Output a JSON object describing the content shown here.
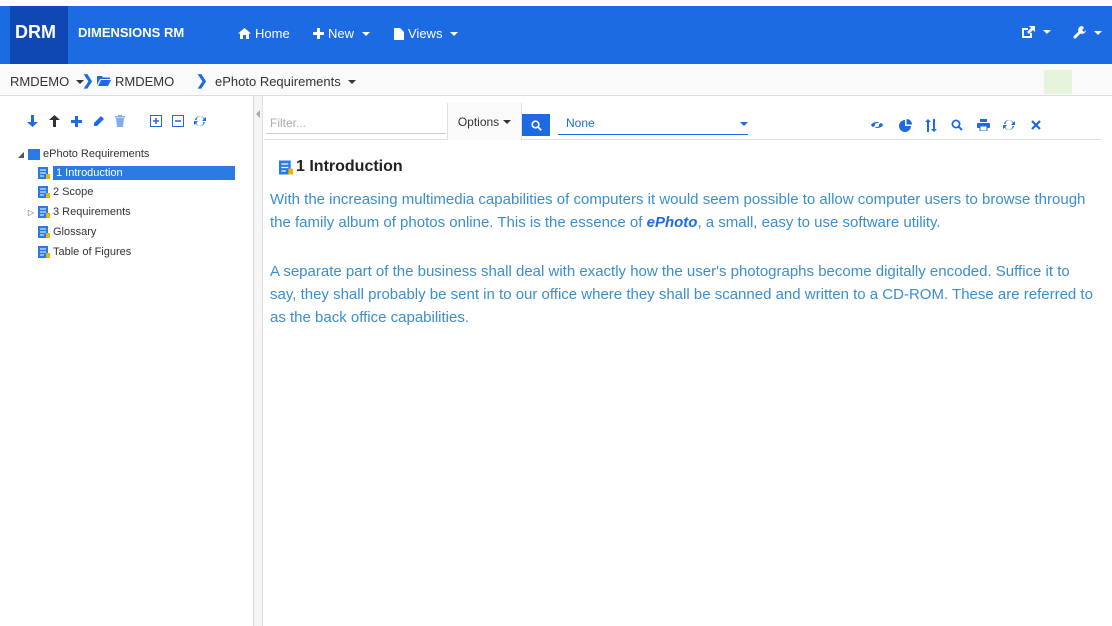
{
  "header": {
    "logo": "DRM",
    "product": "DIMENSIONS RM",
    "nav": [
      {
        "label": "Home",
        "icon": "home-icon"
      },
      {
        "label": "New",
        "icon": "plus-icon"
      },
      {
        "label": "Views",
        "icon": "file-icon"
      }
    ],
    "right_icons": [
      "export-icon",
      "wrench-icon"
    ],
    "accent": "#1c6be3"
  },
  "breadcrumb": {
    "items": [
      "RMDEMO",
      "RMDEMO",
      "ePhoto Requirements"
    ]
  },
  "left_toolbar": {
    "icons": [
      "arrow-down-icon",
      "arrow-up-icon",
      "plus-icon",
      "pencil-icon",
      "trash-icon",
      "expand-all-icon",
      "collapse-all-icon",
      "refresh-icon"
    ]
  },
  "tree": {
    "root": "ePhoto Requirements",
    "items": [
      {
        "label": "1 Introduction",
        "selected": true
      },
      {
        "label": "2 Scope",
        "selected": false
      },
      {
        "label": "3 Requirements",
        "selected": false,
        "expandable": true
      },
      {
        "label": "Glossary",
        "selected": false
      },
      {
        "label": "Table of Figures",
        "selected": false
      }
    ]
  },
  "right_toolbar": {
    "filter_placeholder": "Filter...",
    "options_label": "Options",
    "view_value": "None",
    "icons": [
      "eye-slash-icon",
      "pie-chart-icon",
      "sort-icon",
      "search-icon",
      "print-icon",
      "refresh-icon",
      "close-icon"
    ]
  },
  "document": {
    "title": "1 Introduction",
    "para1_before": "With the increasing multimedia capabilities of computers it would seem possible to allow computer users to browse through the family album of photos online. This is the essence of ",
    "para1_emph": "ePhoto",
    "para1_after": ", a small, easy to use software utility.",
    "para2": "A separate part of the business shall deal with exactly how the user's photographs become digitally encoded. Suffice it to say, they shall probably be sent in to our office where they shall be scanned and written to a CD-ROM. These are referred to as the back office capabilities."
  }
}
